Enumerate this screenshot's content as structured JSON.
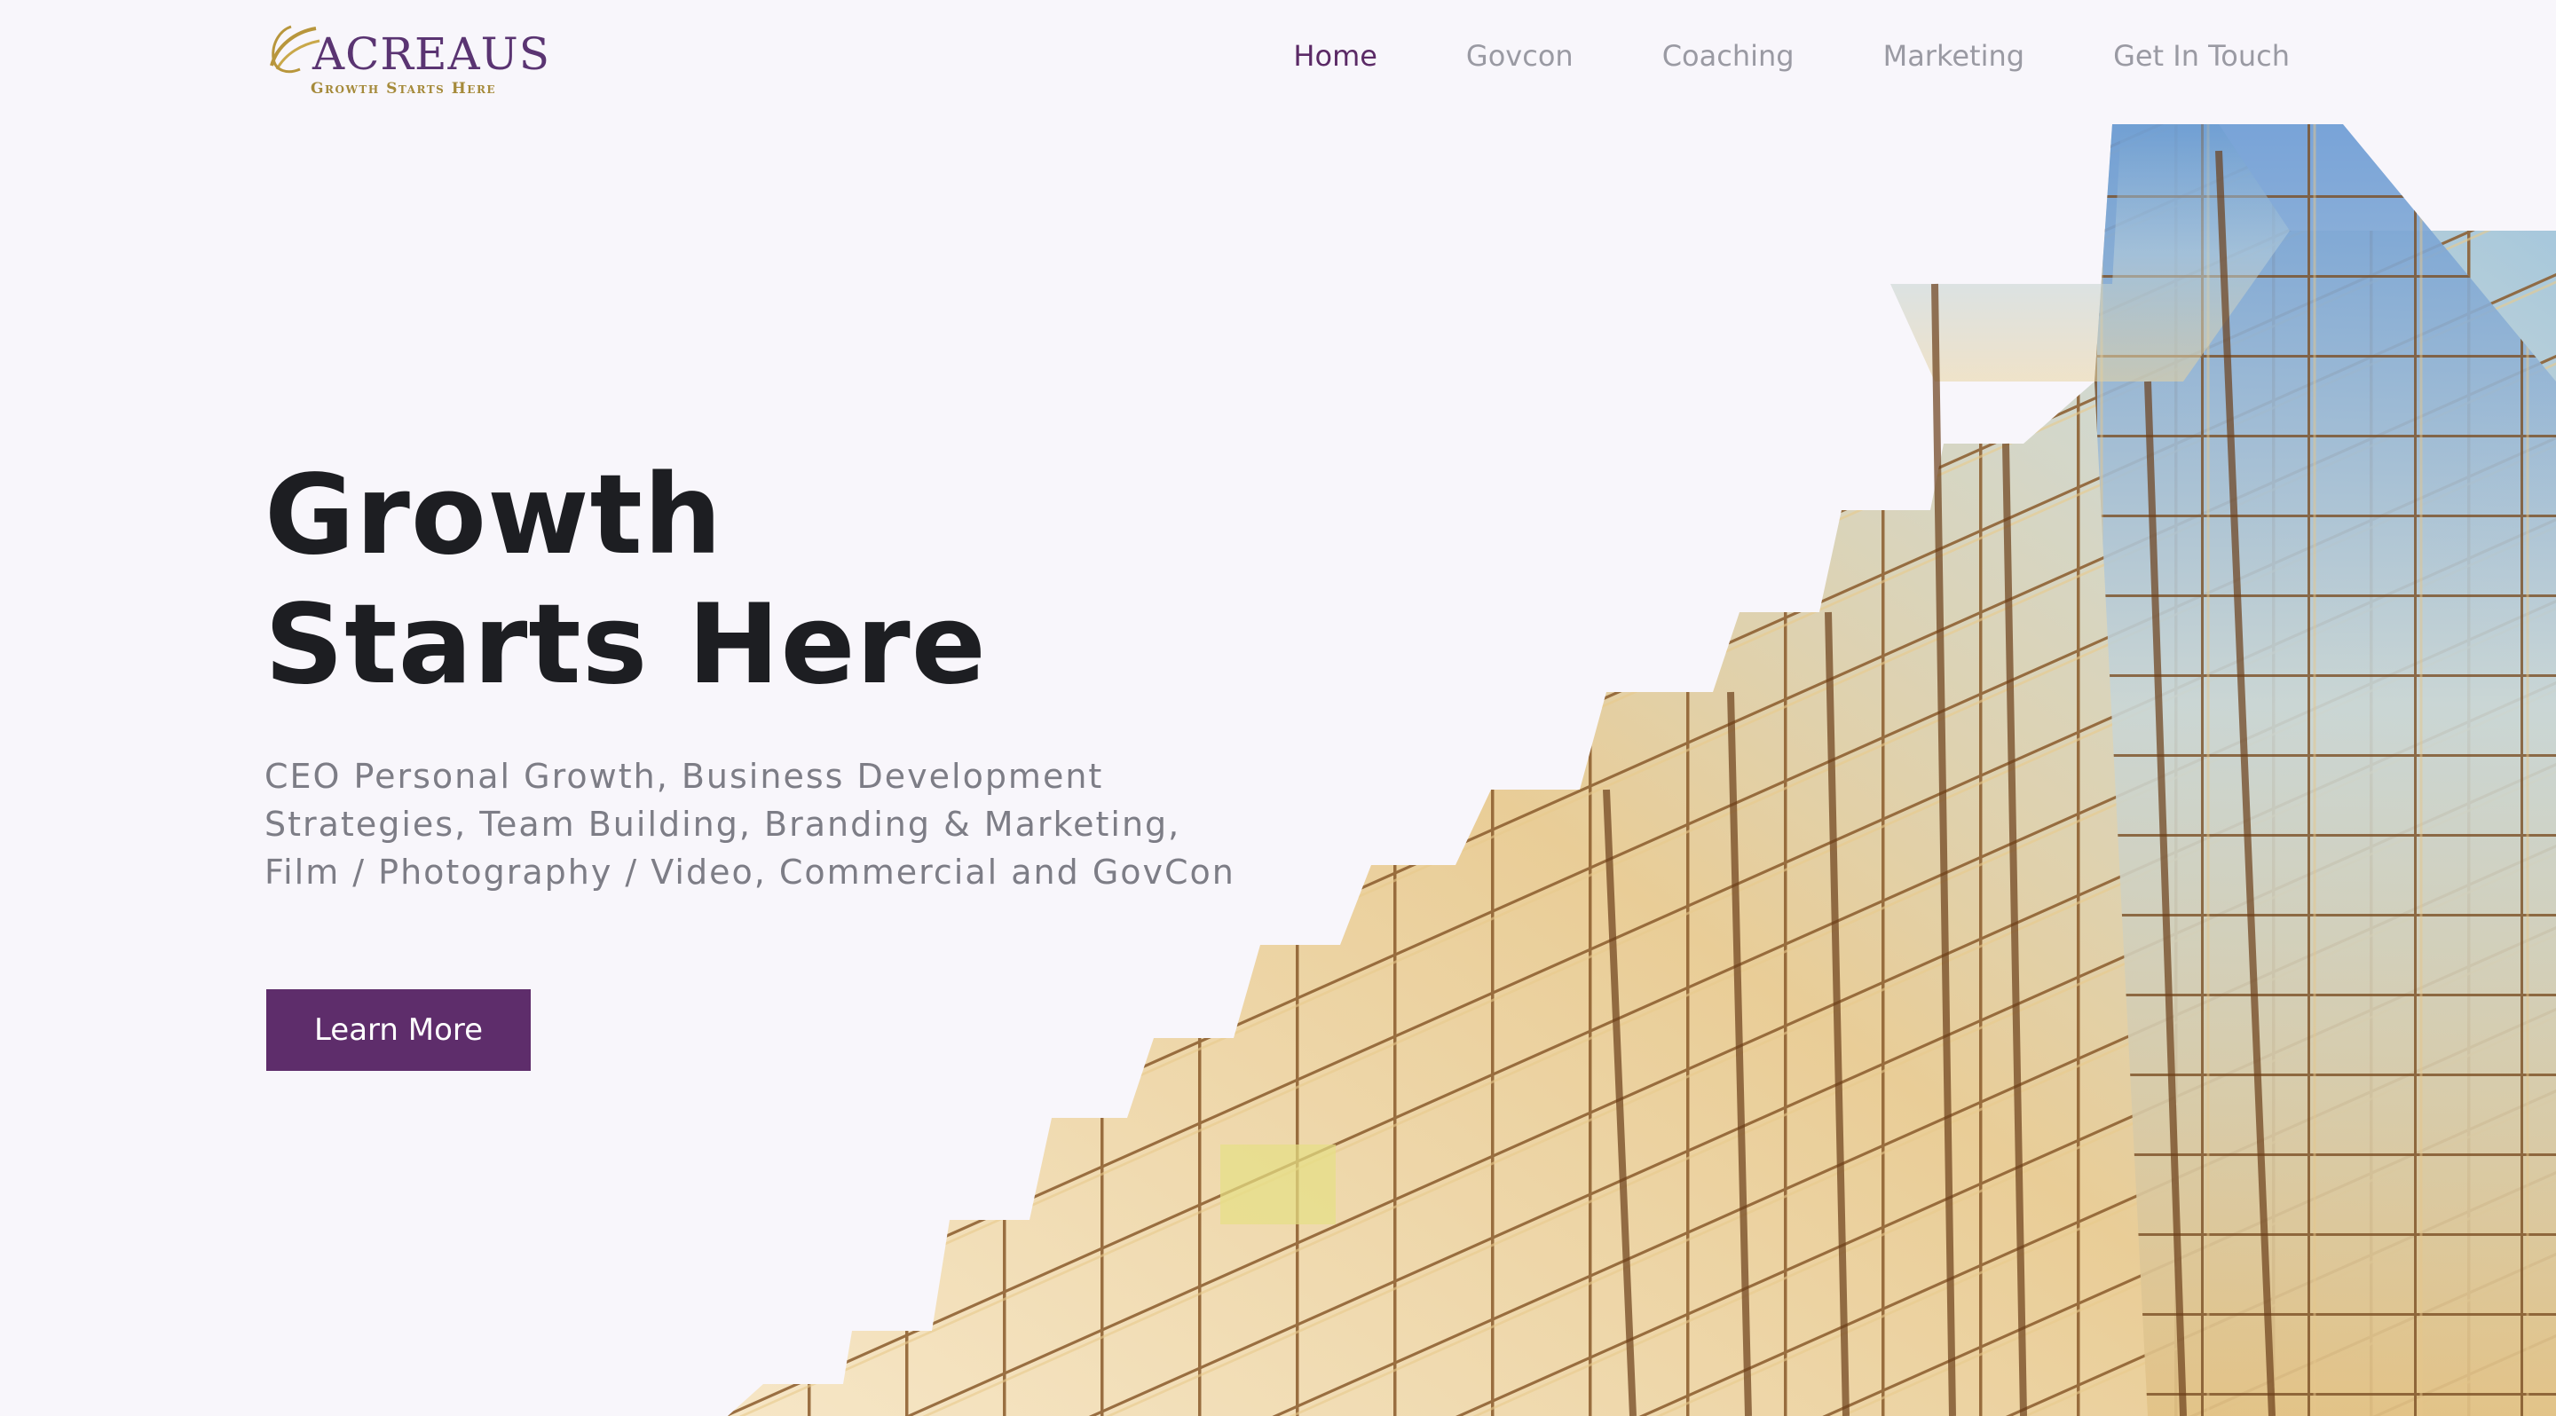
{
  "brand": {
    "name": "ACREAUS",
    "tagline": "Growth Starts Here"
  },
  "nav": {
    "items": [
      {
        "label": "Home",
        "active": true
      },
      {
        "label": "Govcon",
        "active": false
      },
      {
        "label": "Coaching",
        "active": false
      },
      {
        "label": "Marketing",
        "active": false
      },
      {
        "label": "Get In Touch",
        "active": false
      }
    ]
  },
  "hero": {
    "title_line1": "Growth",
    "title_line2": "Starts Here",
    "subtitle": "CEO Personal Growth, Business Development Strategies, Team Building, Branding & Marketing, Film / Photography / Video, Commercial and GovCon",
    "cta_label": "Learn More",
    "image_icon": "glass-building-photo"
  },
  "colors": {
    "accent": "#5e2d6b",
    "nav_active": "#5b2a66",
    "nav_inactive": "#9a9aa3",
    "logo_gold": "#a58a3a",
    "background": "#f8f6fb"
  }
}
